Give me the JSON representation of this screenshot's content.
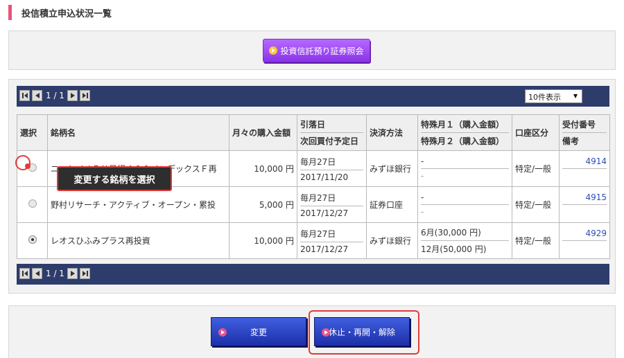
{
  "page": {
    "title": "投信積立申込状況一覧"
  },
  "top": {
    "inquiry_button": "投資信託預り証券照会"
  },
  "pager": {
    "text": "1 / 1",
    "per_page": "10件表示"
  },
  "table": {
    "headers": {
      "select": "選択",
      "fund": "銘柄名",
      "monthly": "月々の購入金額",
      "debit_1": "引落日",
      "debit_2": "次回買付予定日",
      "payment": "決済方法",
      "special_1": "特殊月１（購入金額）",
      "special_2": "特殊月２（購入金額）",
      "account": "口座区分",
      "receipt_1": "受付番号",
      "receipt_2": "備考"
    },
    "rows": [
      {
        "fund": "ニッセイＪＰＸ日経４００インデックスＦ再",
        "amount": "10,000 円",
        "debit_day": "毎月27日",
        "next_date": "2017/11/20",
        "payment": "みずほ銀行",
        "special1": "-",
        "special2": "-",
        "account": "特定/一般",
        "receipt": "4914",
        "note": ""
      },
      {
        "fund": "野村リサーチ・アクティブ・オープン・累投",
        "amount": "5,000 円",
        "debit_day": "毎月27日",
        "next_date": "2017/12/27",
        "payment": "証券口座",
        "special1": "-",
        "special2": "-",
        "account": "特定/一般",
        "receipt": "4915",
        "note": ""
      },
      {
        "fund": "レオスひふみプラス再投資",
        "amount": "10,000 円",
        "debit_day": "毎月27日",
        "next_date": "2017/12/27",
        "payment": "みずほ銀行",
        "special1": "6月(30,000 円)",
        "special2": "12月(50,000 円)",
        "account": "特定/一般",
        "receipt": "4929",
        "note": ""
      }
    ]
  },
  "callout": {
    "text": "変更する銘柄を選択"
  },
  "buttons": {
    "change": "変更",
    "stop": "休止・再開・解除"
  }
}
